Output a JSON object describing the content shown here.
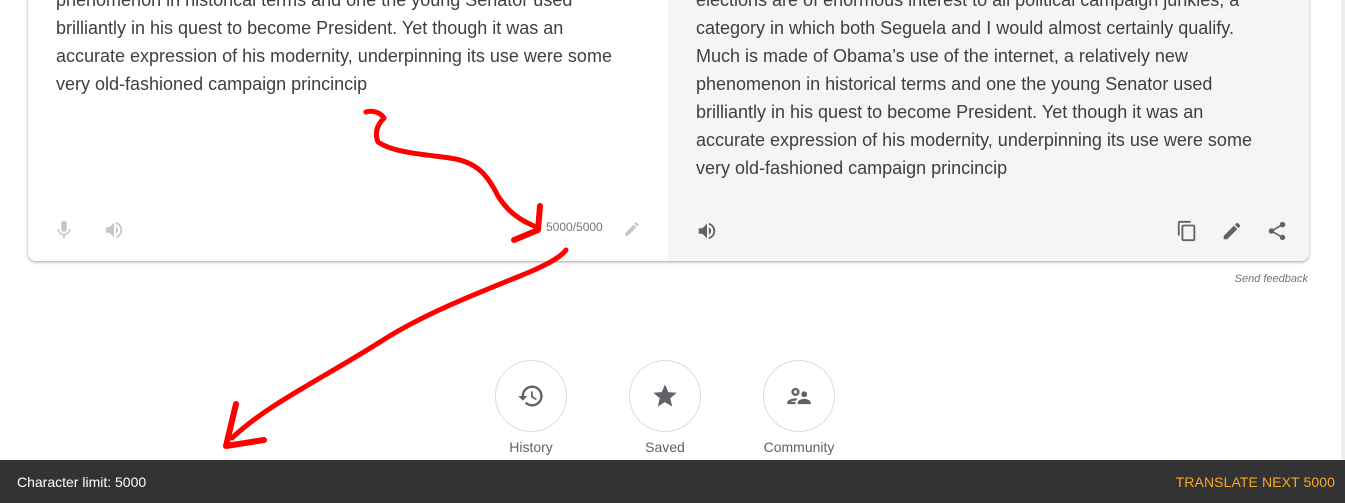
{
  "source_pane": {
    "text": "phenomenon in historical terms and one the young Senator used brilliantly in his quest to become President. Yet though it was an accurate expression of his modernity, underpinning its use were some very old-fashioned campaign princincip",
    "char_count": "5000/5000",
    "icons": [
      "microphone-icon",
      "speaker-icon",
      "pencil-icon"
    ]
  },
  "target_pane": {
    "text": "elections are of enormous interest to all political campaign junkies, a category in which both Seguela and I would almost certainly qualify. Much is made of Obama’s use of the internet, a relatively new phenomenon in historical terms and one the young Senator used brilliantly in his quest to become President. Yet though it was an accurate expression of his modernity, underpinning its use were some very old-fashioned campaign princincip",
    "icons": [
      "speaker-icon",
      "copy-icon",
      "pencil-icon",
      "share-icon"
    ]
  },
  "feedback_label": "Send feedback",
  "nav": {
    "items": [
      {
        "label": "History",
        "icon": "history-icon"
      },
      {
        "label": "Saved",
        "icon": "star-icon"
      },
      {
        "label": "Community",
        "icon": "community-icon"
      }
    ]
  },
  "bottom_bar": {
    "left_text": "Character limit: 5000",
    "right_text": "TRANSLATE NEXT 5000"
  },
  "colors": {
    "bottom_bar_bg": "#333333",
    "action_text": "#f9a825",
    "annotation": "#ff0000",
    "target_pane_bg": "#f5f5f5"
  }
}
